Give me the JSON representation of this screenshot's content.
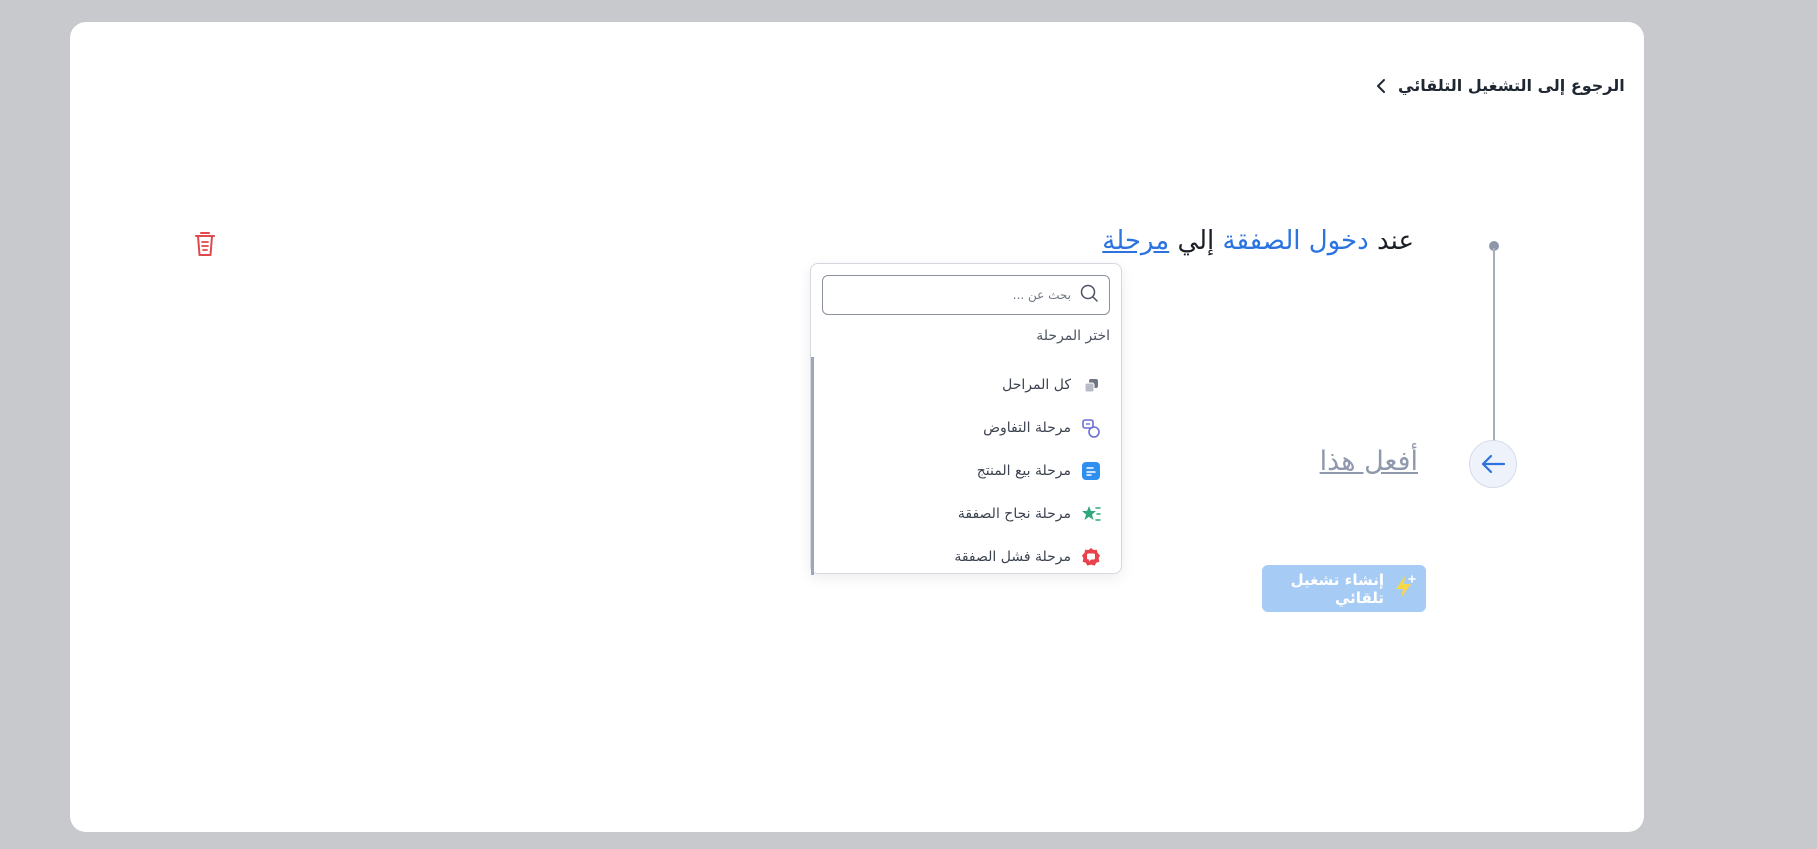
{
  "header": {
    "back_label": "الرجوع إلى التشغيل التلقائي"
  },
  "trigger": {
    "prefix": "عند",
    "event": "دخول الصفقة",
    "connector": "إلي",
    "stage_link": "مرحلة"
  },
  "action": {
    "label": "أفعل هذا"
  },
  "create_button": {
    "label": "إنشاء تشغيل تلقائي"
  },
  "dropdown": {
    "search_placeholder": "بحث عن ...",
    "header": "اختر المرحلة",
    "items": [
      {
        "label": "كل المراحل",
        "icon": "stack-icon"
      },
      {
        "label": "مرحلة التفاوض",
        "icon": "negotiation-icon"
      },
      {
        "label": "مرحلة بيع المنتج",
        "icon": "document-icon"
      },
      {
        "label": "مرحلة نجاح الصفقة",
        "icon": "star-list-icon"
      },
      {
        "label": "مرحلة فشل الصفقة",
        "icon": "badge-alert-icon"
      }
    ]
  },
  "colors": {
    "accent": "#2b73e0",
    "danger": "#e0484b",
    "button_bg": "#a6cbf4",
    "muted": "#8f98ac"
  }
}
